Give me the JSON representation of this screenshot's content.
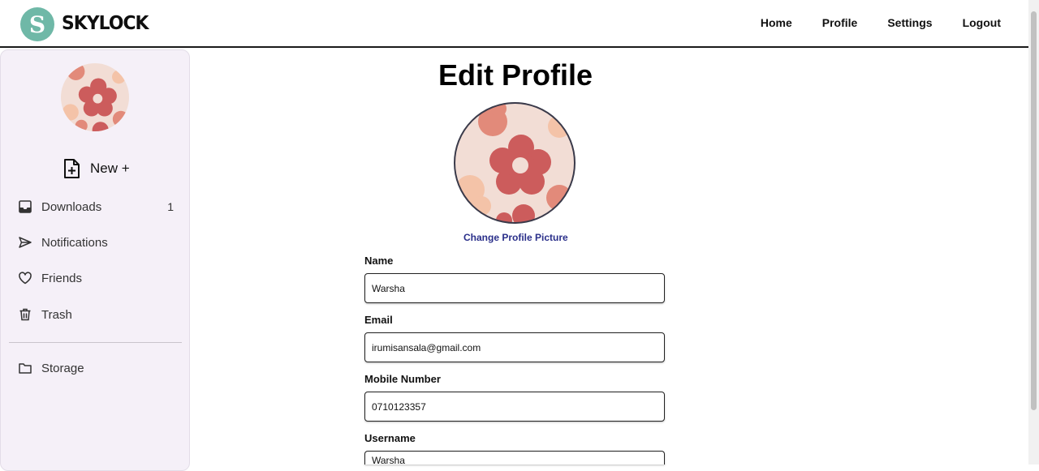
{
  "header": {
    "logo_letter": "S",
    "brand": "SKYLOCK",
    "nav": [
      "Home",
      "Profile",
      "Settings",
      "Logout"
    ]
  },
  "sidebar": {
    "new_label": "New +",
    "items": [
      {
        "label": "Downloads",
        "icon": "inbox-icon",
        "count": "1"
      },
      {
        "label": "Notifications",
        "icon": "send-icon",
        "count": ""
      },
      {
        "label": "Friends",
        "icon": "heart-icon",
        "count": ""
      },
      {
        "label": "Trash",
        "icon": "trash-icon",
        "count": ""
      },
      {
        "label": "Storage",
        "icon": "folder-icon",
        "count": ""
      }
    ]
  },
  "main": {
    "title": "Edit Profile",
    "change_picture": "Change Profile Picture",
    "fields": [
      {
        "label": "Name",
        "value": "Warsha"
      },
      {
        "label": "Email",
        "value": "irumisansala@gmail.com"
      },
      {
        "label": "Mobile Number",
        "value": "0710123357"
      },
      {
        "label": "Username",
        "value": "Warsha"
      }
    ]
  },
  "colors": {
    "brand_teal": "#6fb8a7",
    "sidebar_bg": "#f5f0f8",
    "link_blue": "#2a2f8a",
    "flower_red": "#cc5c5c",
    "avatar_bg": "#f2ddd5"
  }
}
